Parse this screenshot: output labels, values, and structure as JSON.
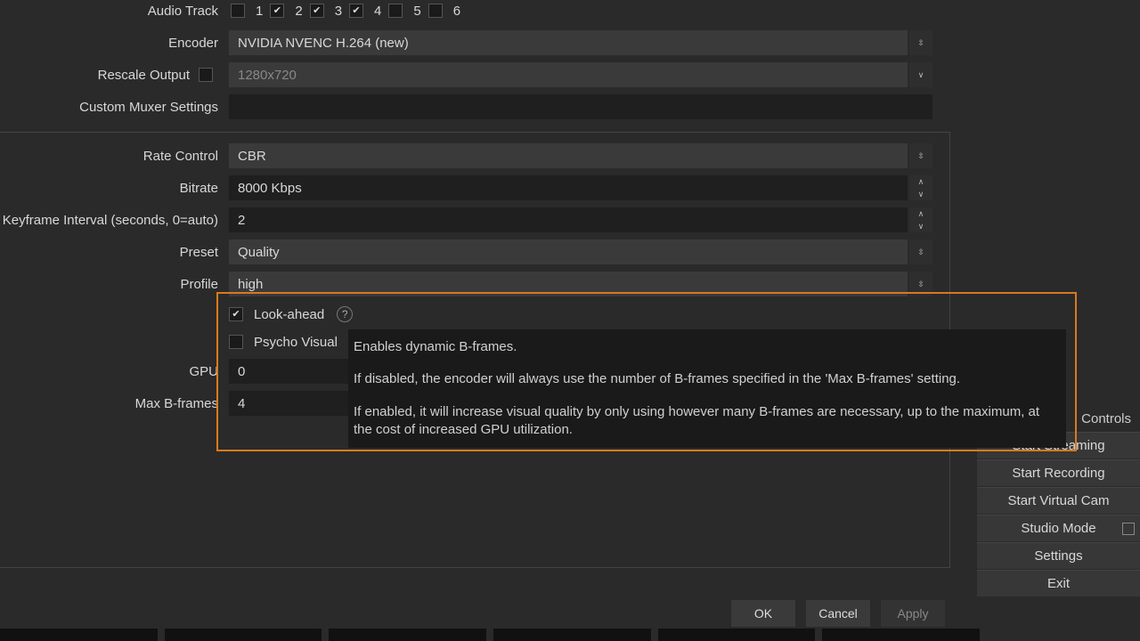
{
  "top": {
    "audio_track_label": "Audio Track",
    "tracks": [
      "1",
      "2",
      "3",
      "4",
      "5",
      "6"
    ],
    "tracks_checked": [
      false,
      true,
      true,
      true,
      false,
      false
    ],
    "encoder_label": "Encoder",
    "encoder_value": "NVIDIA NVENC H.264 (new)",
    "rescale_label": "Rescale Output",
    "rescale_checked": false,
    "rescale_value": "1280x720",
    "muxer_label": "Custom Muxer Settings",
    "muxer_value": ""
  },
  "enc": {
    "rate_control_label": "Rate Control",
    "rate_control_value": "CBR",
    "bitrate_label": "Bitrate",
    "bitrate_value": "8000 Kbps",
    "keyframe_label": "Keyframe Interval (seconds, 0=auto)",
    "keyframe_value": "2",
    "preset_label": "Preset",
    "preset_value": "Quality",
    "profile_label": "Profile",
    "profile_value": "high",
    "lookahead_label": "Look-ahead",
    "lookahead_checked": true,
    "psycho_label": "Psycho Visual",
    "psycho_checked": false,
    "gpu_label": "GPU",
    "gpu_value": "0",
    "maxb_label": "Max B-frames",
    "maxb_value": "4"
  },
  "tooltip": {
    "p1": "Enables dynamic B-frames.",
    "p2": "If disabled, the encoder will always use the number of B-frames specified in the 'Max B-frames' setting.",
    "p3": "If enabled, it will increase visual quality by only using however many B-frames are necessary, up to the maximum, at the cost of increased GPU utilization."
  },
  "buttons": {
    "ok": "OK",
    "cancel": "Cancel",
    "apply": "Apply"
  },
  "side": {
    "title": "Controls",
    "items": [
      "Start Streaming",
      "Start Recording",
      "Start Virtual Cam",
      "Studio Mode",
      "Settings",
      "Exit"
    ]
  }
}
